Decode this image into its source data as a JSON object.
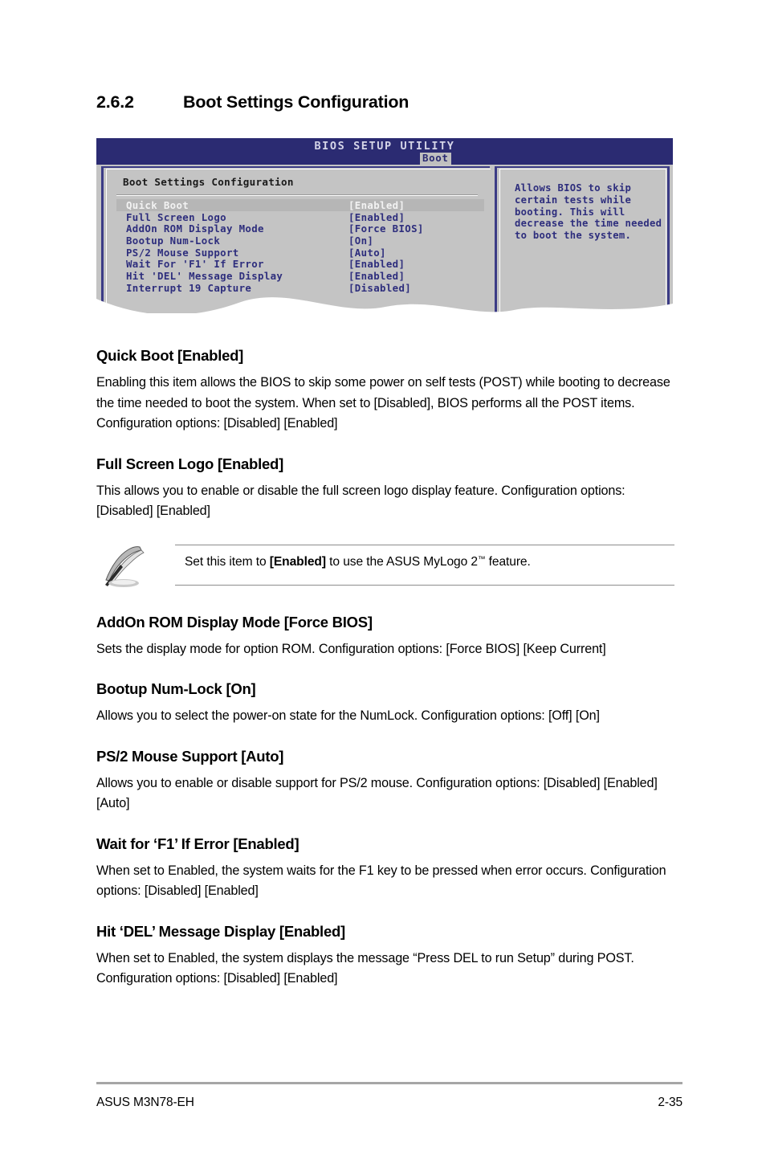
{
  "section": {
    "number": "2.6.2",
    "title": "Boot Settings Configuration"
  },
  "bios_screen": {
    "title": "BIOS SETUP UTILITY",
    "active_tab": "Boot",
    "panel_title": "Boot Settings Configuration",
    "items": [
      {
        "label": "Quick Boot",
        "value": "[Enabled]",
        "selected": true
      },
      {
        "label": "Full Screen Logo",
        "value": "[Enabled]",
        "selected": false
      },
      {
        "label": "AddOn ROM Display Mode",
        "value": "[Force BIOS]",
        "selected": false
      },
      {
        "label": "Bootup Num-Lock",
        "value": "[On]",
        "selected": false
      },
      {
        "label": "PS/2 Mouse Support",
        "value": "[Auto]",
        "selected": false
      },
      {
        "label": "Wait For 'F1' If Error",
        "value": "[Enabled]",
        "selected": false
      },
      {
        "label": "Hit 'DEL' Message Display",
        "value": "[Enabled]",
        "selected": false
      },
      {
        "label": "Interrupt 19 Capture",
        "value": "[Disabled]",
        "selected": false
      }
    ],
    "help_text": "Allows BIOS to skip certain tests while booting. This will decrease the time needed to boot the system.",
    "colors": {
      "titlebar": "#2b2b72",
      "panel_background": "#c4c4c4",
      "text": "#2e2e7d",
      "border": "#3b3b86",
      "selected_row": "#b6b6b6"
    }
  },
  "sections": [
    {
      "heading": "Quick Boot [Enabled]",
      "body": "Enabling this item allows the BIOS to skip some power on self tests (POST) while booting to decrease the time needed to boot the system. When set to [Disabled], BIOS performs all the POST items. Configuration options: [Disabled] [Enabled]"
    },
    {
      "heading": "Full Screen Logo [Enabled]",
      "body": "This allows you to enable or disable the full screen logo display feature. Configuration options: [Disabled] [Enabled]"
    },
    {
      "heading": "AddOn ROM Display Mode [Force BIOS]",
      "body": "Sets the display mode for option ROM. Configuration options: [Force BIOS] [Keep Current]"
    },
    {
      "heading": "Bootup Num-Lock [On]",
      "body": "Allows you to select the power-on state for the NumLock. Configuration options: [Off] [On]"
    },
    {
      "heading": "PS/2 Mouse Support [Auto]",
      "body": "Allows you to enable or disable support for PS/2 mouse. Configuration options: [Disabled] [Enabled] [Auto]"
    },
    {
      "heading": "Wait for ‘F1’ If Error [Enabled]",
      "body": "When set to Enabled, the system waits for the F1 key to be pressed when error occurs. Configuration options: [Disabled] [Enabled]"
    },
    {
      "heading": "Hit ‘DEL’ Message Display [Enabled]",
      "body": "When set to Enabled, the system displays the message “Press DEL to run Setup” during POST. Configuration options: [Disabled] [Enabled]"
    }
  ],
  "note": {
    "icon": "quill-pen-icon",
    "prefix": "Set this item to ",
    "bold": "[Enabled]",
    "suffix": " to use the ASUS MyLogo 2",
    "trademark": "™",
    "tail": " feature."
  },
  "footer": {
    "left": "ASUS M3N78-EH",
    "right": "2-35"
  }
}
